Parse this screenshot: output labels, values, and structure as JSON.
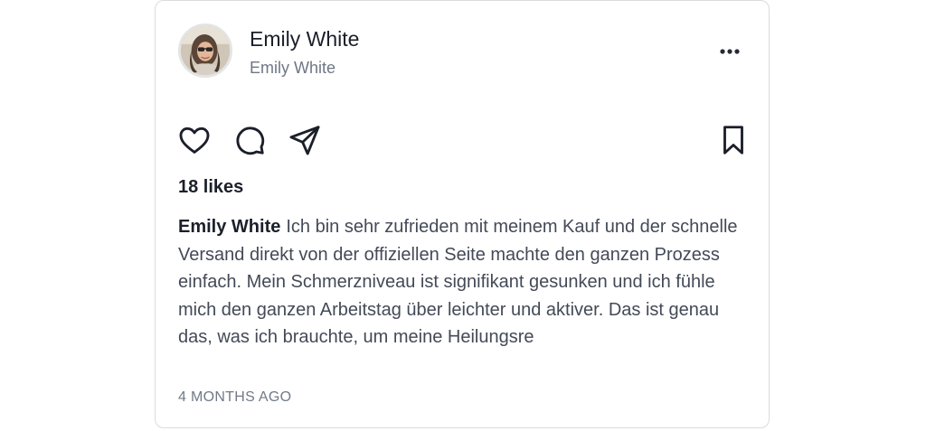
{
  "post": {
    "user": {
      "name": "Emily White",
      "handle": "Emily White",
      "avatar_icon": "user-avatar-photo"
    },
    "menu_icon": "more-horizontal-icon",
    "actions": {
      "like_icon": "heart-icon",
      "comment_icon": "comment-icon",
      "share_icon": "send-icon",
      "save_icon": "bookmark-icon"
    },
    "likes_text": "18 likes",
    "caption": {
      "username": "Emily White",
      "text": "Ich bin sehr zufrieden mit meinem Kauf und der schnelle Versand direkt von der offiziellen Seite machte den ganzen Prozess einfach. Mein Schmerzniveau ist signifikant gesunken und ich fühle mich den ganzen Arbeitstag über leichter und aktiver. Das ist genau das, was ich brauchte, um meine Heilungsre"
    },
    "timestamp": "4 MONTHS AGO"
  },
  "colors": {
    "text_primary": "#1b1f2a",
    "text_secondary": "#6f7785",
    "border": "#dbdbdb"
  }
}
